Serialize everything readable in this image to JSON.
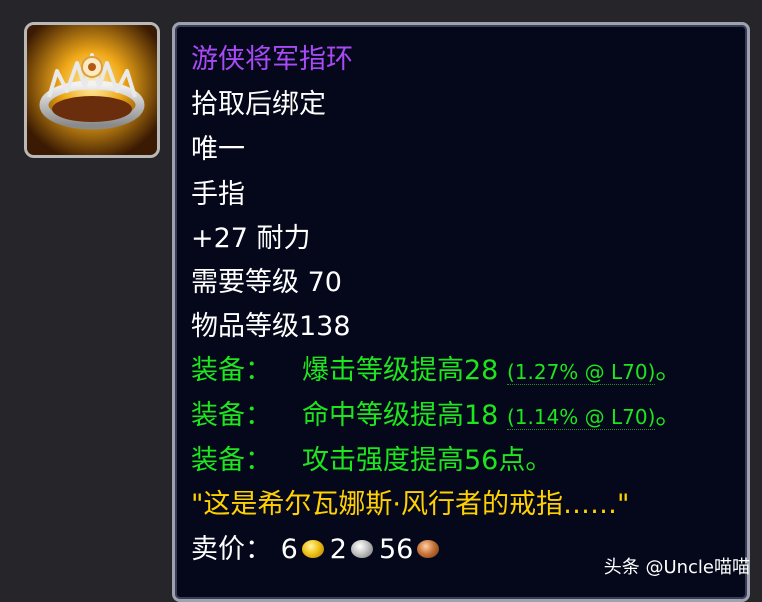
{
  "item": {
    "name": "游侠将军指环",
    "binding": "拾取后绑定",
    "unique": "唯一",
    "slot": "手指",
    "stat": "+27 耐力",
    "required_level": "需要等级 70",
    "item_level": "物品等级138",
    "equip_effects": [
      {
        "prefix": "装备：",
        "text": "爆击等级提高28",
        "detail": "(1.27% @ L70)",
        "suffix": "。"
      },
      {
        "prefix": "装备：",
        "text": "命中等级提高18",
        "detail": "(1.14% @ L70)",
        "suffix": "。"
      },
      {
        "prefix": "装备：",
        "text": "攻击强度提高56点。",
        "detail": "",
        "suffix": ""
      }
    ],
    "flavor": "\"这是希尔瓦娜斯·风行者的戒指……\"",
    "sell_price": {
      "label": "卖价：",
      "gold": "6",
      "silver": "2",
      "copper": "56"
    },
    "icon": "ring-icon"
  },
  "colors": {
    "epic": "#a84af6",
    "equip": "#1ee51e",
    "flavor": "#ffd100",
    "white": "#ffffff"
  },
  "watermark": "头条 @Uncle喵喵"
}
